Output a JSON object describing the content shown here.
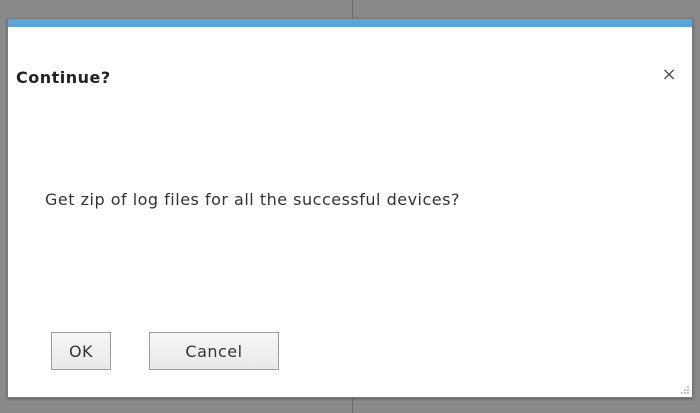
{
  "dialog": {
    "title": "Continue?",
    "close_label": "×",
    "message": "Get zip of log files for all the successful devices?",
    "ok_label": "OK",
    "cancel_label": "Cancel"
  },
  "colors": {
    "accent": "#5aa4da",
    "backdrop": "#8a8a8a"
  },
  "icons": {
    "close": "close-icon",
    "resize": "resize-grip-icon"
  }
}
